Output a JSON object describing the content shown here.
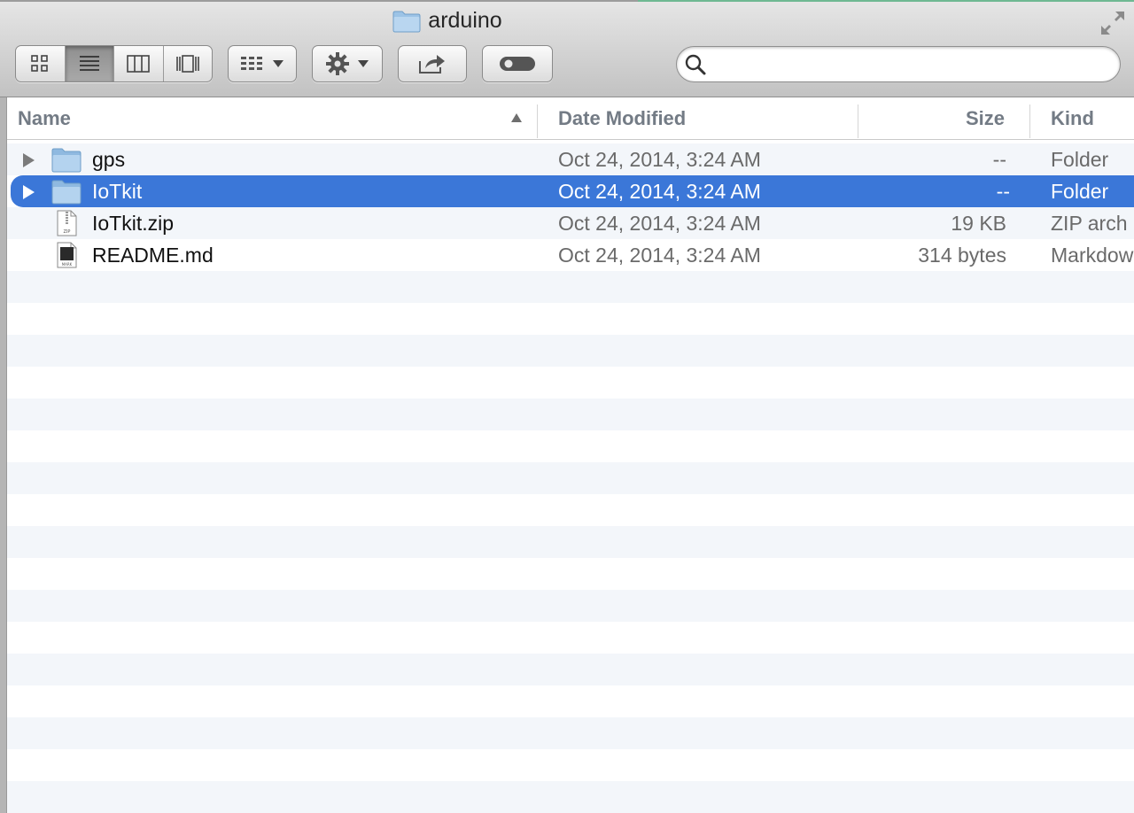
{
  "window": {
    "title": "arduino",
    "title_icon": "folder-icon",
    "resize_icon": "fullscreen-arrows-icon"
  },
  "toolbar": {
    "view_buttons": [
      {
        "name": "icon-view",
        "icon": "icon-grid-icon",
        "active": false
      },
      {
        "name": "list-view",
        "icon": "list-lines-icon",
        "active": true
      },
      {
        "name": "column-view",
        "icon": "columns-icon",
        "active": false
      },
      {
        "name": "cover-flow-view",
        "icon": "cover-flow-icon",
        "active": false
      }
    ],
    "arrange_icon": "arrange-grid-icon",
    "action_icon": "gear-icon",
    "share_icon": "share-arrow-icon",
    "tags_icon": "toggle-pill-icon",
    "search": {
      "placeholder": "",
      "value": "",
      "icon": "magnifier-icon"
    }
  },
  "columns": {
    "name": "Name",
    "date_modified": "Date Modified",
    "size": "Size",
    "kind": "Kind",
    "sort_indicator": "sort-ascending-icon"
  },
  "files": [
    {
      "name": "gps",
      "date": "Oct 24, 2014, 3:24 AM",
      "size": "--",
      "kind": "Folder",
      "icon": "folder-icon",
      "expandable": true,
      "selected": false
    },
    {
      "name": "IoTkit",
      "date": "Oct 24, 2014, 3:24 AM",
      "size": "--",
      "kind": "Folder",
      "icon": "folder-icon",
      "expandable": true,
      "selected": true
    },
    {
      "name": "IoTkit.zip",
      "date": "Oct 24, 2014, 3:24 AM",
      "size": "19 KB",
      "kind": "ZIP arch",
      "icon": "zip-file-icon",
      "expandable": false,
      "selected": false
    },
    {
      "name": "README.md",
      "date": "Oct 24, 2014, 3:24 AM",
      "size": "314 bytes",
      "kind": "Markdow",
      "icon": "markdown-file-icon",
      "expandable": false,
      "selected": false
    }
  ],
  "colors": {
    "selection": "#3b77d8",
    "stripe": "#f3f6fa",
    "header_text": "#737b85"
  }
}
